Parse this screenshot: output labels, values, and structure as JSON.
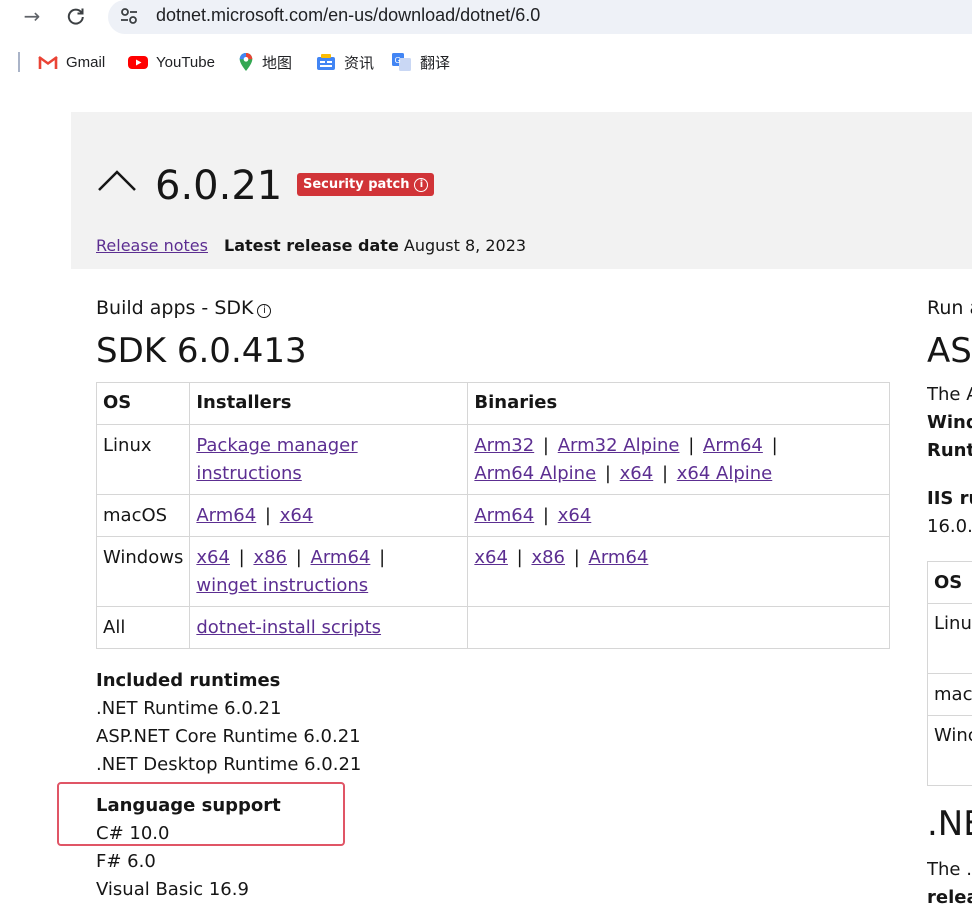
{
  "browser": {
    "url": "dotnet.microsoft.com/en-us/download/dotnet/6.0",
    "bookmarks": [
      {
        "label": "Gmail",
        "icon": "gmail-icon"
      },
      {
        "label": "YouTube",
        "icon": "youtube-icon"
      },
      {
        "label": "地图",
        "icon": "maps-icon"
      },
      {
        "label": "资讯",
        "icon": "news-icon"
      },
      {
        "label": "翻译",
        "icon": "translate-icon"
      }
    ]
  },
  "release": {
    "version": "6.0.21",
    "badge": "Security patch",
    "release_notes_link": "Release notes",
    "latest_date_label": "Latest release date",
    "latest_date_value": "August 8, 2023"
  },
  "sdk": {
    "section_label": "Build apps - SDK",
    "title": "SDK 6.0.413",
    "headers": [
      "OS",
      "Installers",
      "Binaries"
    ],
    "rows": [
      {
        "os": "Linux",
        "installers": [
          "Package manager instructions"
        ],
        "binaries": [
          "Arm32",
          "Arm32 Alpine",
          "Arm64",
          "Arm64 Alpine",
          "x64",
          "x64 Alpine"
        ]
      },
      {
        "os": "macOS",
        "installers": [
          "Arm64",
          "x64"
        ],
        "binaries": [
          "Arm64",
          "x64"
        ]
      },
      {
        "os": "Windows",
        "installers": [
          "x64",
          "x86",
          "Arm64",
          "winget instructions"
        ],
        "binaries": [
          "x64",
          "x86",
          "Arm64"
        ]
      },
      {
        "os": "All",
        "installers": [
          "dotnet-install scripts"
        ],
        "binaries": []
      }
    ]
  },
  "included_runtimes": {
    "heading": "Included runtimes",
    "items": [
      ".NET Runtime 6.0.21",
      "ASP.NET Core Runtime 6.0.21",
      ".NET Desktop Runtime 6.0.21"
    ]
  },
  "language_support": {
    "heading": "Language support",
    "items": [
      "C# 10.0",
      "F# 6.0",
      "Visual Basic 16.9"
    ]
  },
  "right_column": {
    "label": "Run a",
    "title": "AS",
    "line1": "The A",
    "line2": "Wind",
    "line3": "Runt",
    "iis": "IIS ru",
    "iis_version": "16.0.",
    "table_header": "OS",
    "table_rows": [
      "Linu",
      "mac",
      "Winc"
    ],
    "next_title": ".NE",
    "next_line1": "The .",
    "next_line2": "relea"
  },
  "colors": {
    "link": "#5c2e91",
    "badge": "#d13438",
    "highlight": "#e05566"
  }
}
